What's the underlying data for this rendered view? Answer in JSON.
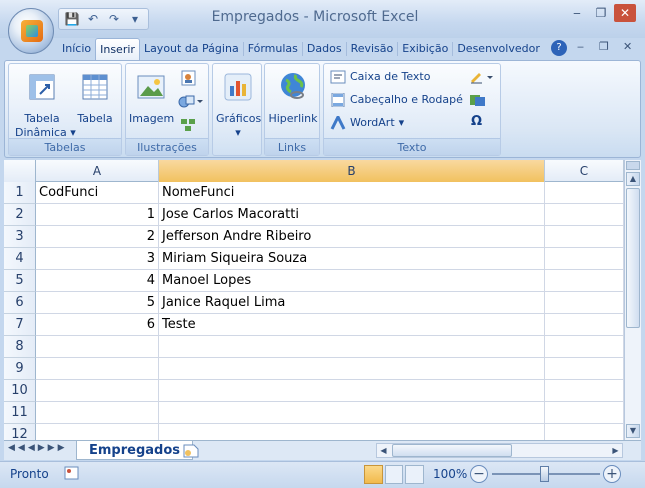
{
  "window": {
    "title": "Empregados - Microsoft Excel",
    "min_glyph": "‒",
    "restore_glyph": "❐",
    "close_glyph": "✕"
  },
  "qat": {
    "save_glyph": "💾",
    "undo_glyph": "↶",
    "redo_glyph": "↷",
    "more_glyph": "▾"
  },
  "ribbon_tabs": [
    "Início",
    "Inserir",
    "Layout da Página",
    "Fórmulas",
    "Dados",
    "Revisão",
    "Exibição",
    "Desenvolvedor"
  ],
  "active_tab": "Inserir",
  "help_glyph": "?",
  "groups": {
    "tabelas": {
      "label": "Tabelas",
      "tabela_dinamica_1": "Tabela",
      "tabela_dinamica_2": "Dinâmica",
      "tabela": "Tabela"
    },
    "ilustracoes": {
      "label": "Ilustrações",
      "imagem": "Imagem"
    },
    "graficos": {
      "label": "Gráficos"
    },
    "links": {
      "label": "Links",
      "hiperlink": "Hiperlink"
    },
    "texto": {
      "label": "Texto",
      "caixa_de_texto": "Caixa de Texto",
      "cabecalho_rodape": "Cabeçalho e Rodapé",
      "wordart": "WordArt",
      "omega": "Ω"
    }
  },
  "grid": {
    "columns": [
      "A",
      "B",
      "C"
    ],
    "rows": [
      {
        "n": "1",
        "a": "CodFunci",
        "b": "NomeFunci"
      },
      {
        "n": "2",
        "a": "1",
        "b": "Jose Carlos Macoratti"
      },
      {
        "n": "3",
        "a": "2",
        "b": "Jefferson Andre Ribeiro"
      },
      {
        "n": "4",
        "a": "3",
        "b": "Miriam Siqueira Souza"
      },
      {
        "n": "5",
        "a": "4",
        "b": "Manoel Lopes"
      },
      {
        "n": "6",
        "a": "5",
        "b": "Janice Raquel Lima"
      },
      {
        "n": "7",
        "a": "6",
        "b": "Teste"
      },
      {
        "n": "8",
        "a": "",
        "b": ""
      },
      {
        "n": "9",
        "a": "",
        "b": ""
      },
      {
        "n": "10",
        "a": "",
        "b": ""
      },
      {
        "n": "11",
        "a": "",
        "b": ""
      },
      {
        "n": "12",
        "a": "",
        "b": ""
      }
    ]
  },
  "sheet_tabs": [
    "Empregados"
  ],
  "status": {
    "ready": "Pronto",
    "zoom": "100%",
    "minus": "−",
    "plus": "+"
  },
  "colors": {
    "selected_col": "#f1c15f",
    "accent": "#15428b"
  }
}
